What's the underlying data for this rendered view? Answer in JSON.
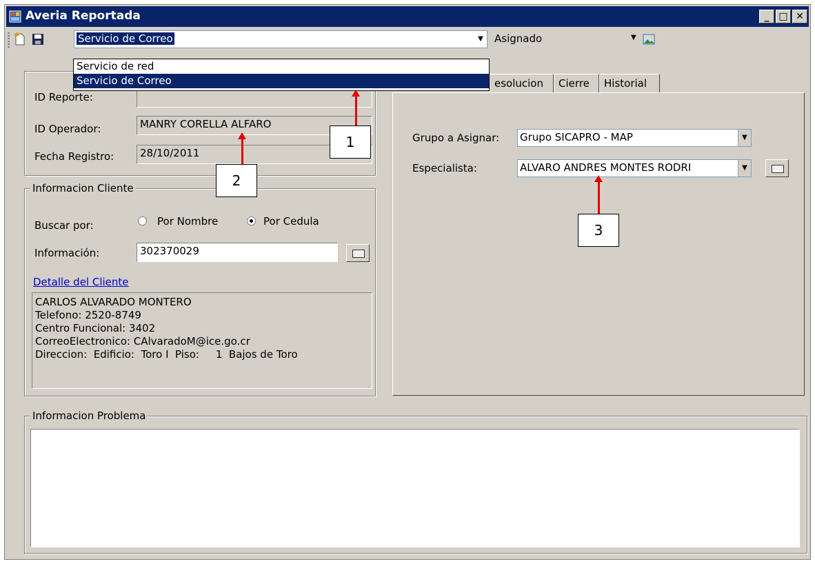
{
  "window": {
    "title": "Averia Reportada"
  },
  "toolbar": {
    "service_value": "Servicio de Correo",
    "status_value": "Asignado",
    "service_options": [
      "Servicio de red",
      "Servicio de Correo"
    ]
  },
  "report": {
    "id_reporte_label": "ID Reporte:",
    "id_operador_label": "ID Operador:",
    "id_operador_value": "MANRY CORELLA ALFARO",
    "fecha_label": "Fecha Registro:",
    "fecha_value": "28/10/2011"
  },
  "cliente": {
    "legend": "Informacion Cliente",
    "buscar_label": "Buscar por:",
    "radio_nombre": "Por Nombre",
    "radio_cedula": "Por Cedula",
    "informacion_label": "Información:",
    "informacion_value": "302370029",
    "detalle_link": "Detalle del Cliente",
    "details": [
      "CARLOS ALVARADO MONTERO",
      "Telefono: 2520-8749",
      "Centro Funcional: 3402",
      "CorreoElectronico: CAlvaradoM@ice.go.cr",
      "Direccion:  Edificio:  Toro I  Piso:     1  Bajos de Toro"
    ]
  },
  "tabs": [
    "esolucion",
    "Cierre",
    "Historial"
  ],
  "asignacion": {
    "grupo_label": "Grupo a Asignar:",
    "grupo_value": "Grupo SICAPRO - MAP",
    "especialista_label": "Especialista:",
    "especialista_value": "ALVARO ANDRES MONTES RODRI"
  },
  "problema": {
    "legend": "Informacion Problema"
  },
  "callouts": [
    "1",
    "2",
    "3"
  ],
  "colors": {
    "titlebar": "#0a246a",
    "selection": "#0a246a",
    "arrow": "#e00000"
  }
}
